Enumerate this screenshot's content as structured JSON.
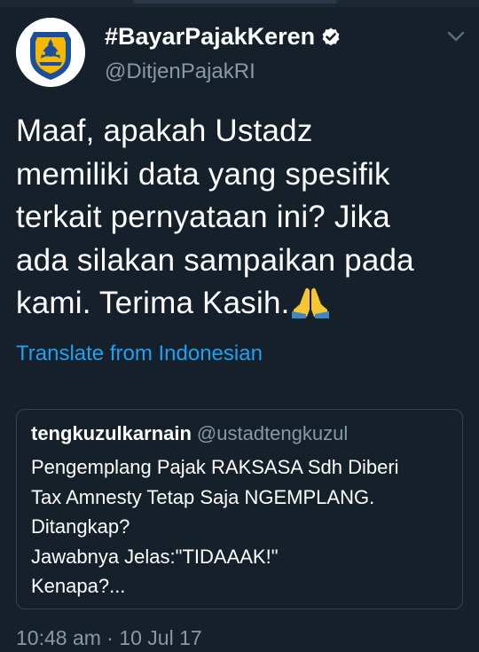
{
  "tweet": {
    "display_name": "#BayarPajakKeren",
    "handle": "@DitjenPajakRI",
    "lines": [
      "Maaf, apakah Ustadz",
      "memiliki data yang spesifik",
      "terkait pernyataan ini? Jika",
      "ada silakan sampaikan pada",
      "kami. Terima Kasih."
    ],
    "emoji": "folded-hands",
    "translate_label": "Translate from Indonesian",
    "timestamp": "10:48 am · 10 Jul 17"
  },
  "quoted": {
    "name": "tengkuzulkarnain",
    "handle": "@ustadtengkuzul",
    "lines": [
      "Pengemplang Pajak RAKSASA Sdh Diberi",
      "Tax Amnesty Tetap Saja NGEMPLANG.",
      "Ditangkap?",
      "Jawabnya Jelas:\"TIDAAAK!\"",
      "Kenapa?..."
    ]
  },
  "icons": {
    "avatar": "ditjen-pajak-logo",
    "verified": "verified-badge-icon",
    "menu": "chevron-down-icon"
  },
  "colors": {
    "background": "#15202b",
    "link": "#1da1f2",
    "secondary_text": "#8899a6",
    "logo_blue": "#1b4f9c",
    "logo_gold": "#f5b800"
  }
}
